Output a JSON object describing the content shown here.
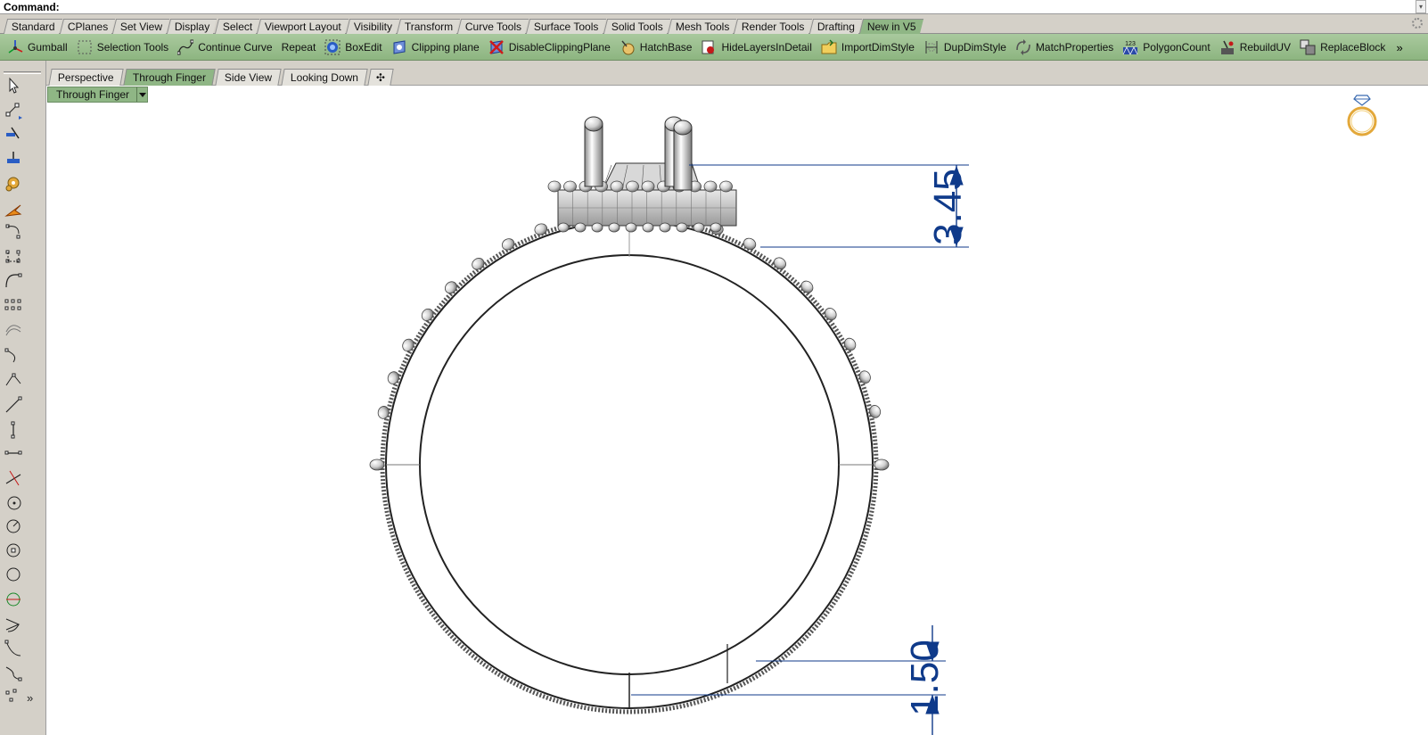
{
  "command": {
    "label": "Command:",
    "value": ""
  },
  "toolbar_tabs": [
    "Standard",
    "CPlanes",
    "Set View",
    "Display",
    "Select",
    "Viewport Layout",
    "Visibility",
    "Transform",
    "Curve Tools",
    "Surface Tools",
    "Solid Tools",
    "Mesh Tools",
    "Render Tools",
    "Drafting",
    "New in V5"
  ],
  "toolbar_tab_active": "New in V5",
  "command_buttons": [
    {
      "label": "Gumball",
      "icon": "gumball-icon"
    },
    {
      "label": "Selection Tools",
      "icon": "selection-tools-icon"
    },
    {
      "label": "Continue Curve",
      "icon": "continue-curve-icon"
    },
    {
      "label": "Repeat",
      "icon": ""
    },
    {
      "label": "BoxEdit",
      "icon": "boxedit-icon"
    },
    {
      "label": "Clipping plane",
      "icon": "clipping-plane-icon"
    },
    {
      "label": "DisableClippingPlane",
      "icon": "disable-clipping-plane-icon"
    },
    {
      "label": "HatchBase",
      "icon": "hatchbase-icon"
    },
    {
      "label": "HideLayersInDetail",
      "icon": "hide-layers-icon"
    },
    {
      "label": "ImportDimStyle",
      "icon": "import-dimstyle-icon"
    },
    {
      "label": "DupDimStyle",
      "icon": "dup-dimstyle-icon"
    },
    {
      "label": "MatchProperties",
      "icon": "match-properties-icon"
    },
    {
      "label": "PolygonCount",
      "icon": "polygon-count-icon",
      "icon_text": "123"
    },
    {
      "label": "RebuildUV",
      "icon": "rebuild-uv-icon"
    },
    {
      "label": "ReplaceBlock",
      "icon": "replace-block-icon"
    }
  ],
  "more_glyph": "»",
  "viewport_tabs": [
    "Perspective",
    "Through Finger",
    "Side View",
    "Looking Down"
  ],
  "viewport_tab_active": "Through Finger",
  "viewport_add_glyph": "✣",
  "viewport": {
    "title": "Through Finger",
    "dimensions": [
      "3.45",
      "1.50"
    ]
  },
  "colors": {
    "accent_green": "#8fb685",
    "dimension_blue": "#0f3a8a",
    "ring_icon_gold": "#e3a83a"
  }
}
